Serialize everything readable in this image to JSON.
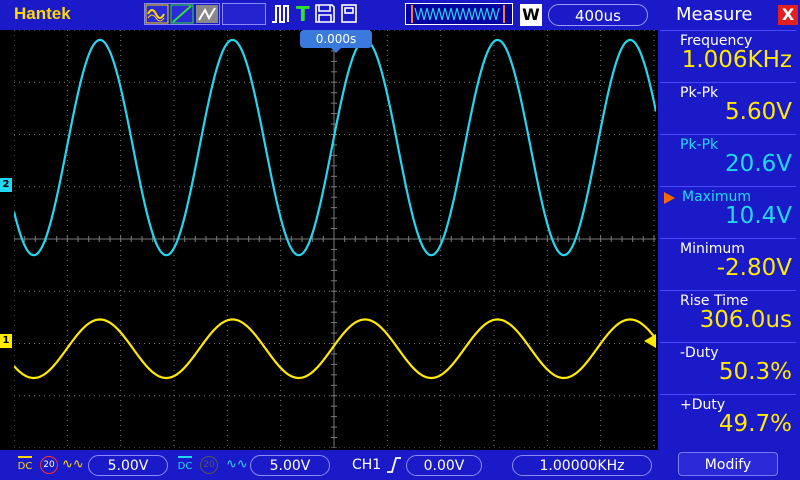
{
  "topbar": {
    "brand": "Hantek",
    "w_label": "W",
    "timebase": "400us",
    "trigger_position": "0.000s"
  },
  "colors": {
    "ch1": "#ffea00",
    "ch2": "#22d8f0",
    "bar_bg": "#1a1ac8",
    "grid": "#7a7a7a"
  },
  "icons": {
    "mode": [
      "sine-icon",
      "ramp-icon",
      "persistence-icon"
    ],
    "trigger": [
      "pulse-icon",
      "trigger-t-icon",
      "save-icon",
      "usb-icon"
    ]
  },
  "channels": {
    "ch1": {
      "marker": "1",
      "coupling": "DC",
      "bw_limit": "20",
      "volts_div": "5.00V"
    },
    "ch2": {
      "marker": "2",
      "coupling": "DC",
      "bw_limit": "20",
      "volts_div": "5.00V"
    }
  },
  "trigger": {
    "source": "CH1",
    "level": "0.00V"
  },
  "frequency_counter": "1.00000KHz",
  "measure": {
    "title": "Measure",
    "close": "X",
    "modify": "Modify",
    "items": [
      {
        "label": "Frequency",
        "value": "1.006KHz",
        "color": "#ffea00",
        "label_color": "#ffffff",
        "selected": false
      },
      {
        "label": "Pk-Pk",
        "value": "5.60V",
        "color": "#ffea00",
        "label_color": "#ffffff",
        "selected": false
      },
      {
        "label": "Pk-Pk",
        "value": "20.6V",
        "color": "#22d8f0",
        "label_color": "#22d8f0",
        "selected": false
      },
      {
        "label": "Maximum",
        "value": "10.4V",
        "color": "#22d8f0",
        "label_color": "#22d8f0",
        "selected": true
      },
      {
        "label": "Minimum",
        "value": "-2.80V",
        "color": "#ffea00",
        "label_color": "#ffffff",
        "selected": false
      },
      {
        "label": "Rise Time",
        "value": "306.0us",
        "color": "#ffea00",
        "label_color": "#ffffff",
        "selected": false
      },
      {
        "label": "-Duty",
        "value": "50.3%",
        "color": "#ffea00",
        "label_color": "#ffffff",
        "selected": false
      },
      {
        "label": "+Duty",
        "value": "49.7%",
        "color": "#ffea00",
        "label_color": "#ffffff",
        "selected": false
      }
    ]
  },
  "waveforms": {
    "ch1": {
      "frequency_khz": 1.006,
      "pk_pk_v": 5.6,
      "min_v": -2.8,
      "offset_div": -2.1
    },
    "ch2": {
      "frequency_khz": 1.006,
      "pk_pk_v": 20.6,
      "min_v": -2.8,
      "offset_div": 1.75
    },
    "volts_per_div": 5.0,
    "time_per_div_us": 400
  }
}
